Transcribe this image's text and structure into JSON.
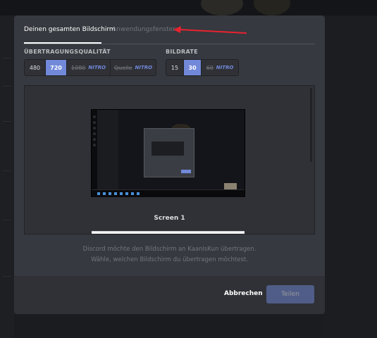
{
  "tabs": [
    {
      "label": "Deinen gesamten Bildschirm",
      "active": true
    },
    {
      "label": "Anwendungsfenster",
      "active": false
    }
  ],
  "quality": {
    "label": "ÜBERTRAGUNGSQUALITÄT",
    "options": [
      {
        "value": "480",
        "selected": false,
        "locked": false
      },
      {
        "value": "720",
        "selected": true,
        "locked": false
      },
      {
        "value": "1080",
        "nitro": "NITRO",
        "selected": false,
        "locked": true
      },
      {
        "value": "Quelle",
        "nitro": "NITRO",
        "selected": false,
        "locked": true
      }
    ]
  },
  "framerate": {
    "label": "BILDRATE",
    "options": [
      {
        "value": "15",
        "selected": false,
        "locked": false
      },
      {
        "value": "30",
        "selected": true,
        "locked": false
      },
      {
        "value": "60",
        "nitro": "NITRO",
        "selected": false,
        "locked": true
      }
    ]
  },
  "screens": [
    {
      "label": "Screen 1",
      "selected": true
    }
  ],
  "note": {
    "line1": "Discord möchte den Bildschirm an KaanIsKun übertragen.",
    "line2": "Wähle, welchen Bildschirm du übertragen möchtest."
  },
  "footer": {
    "cancel_label": "Abbrechen",
    "share_label": "Teilen"
  },
  "colors": {
    "accent": "#7289da",
    "annotation_arrow": "#e8222e",
    "modal_bg": "#36393f"
  }
}
